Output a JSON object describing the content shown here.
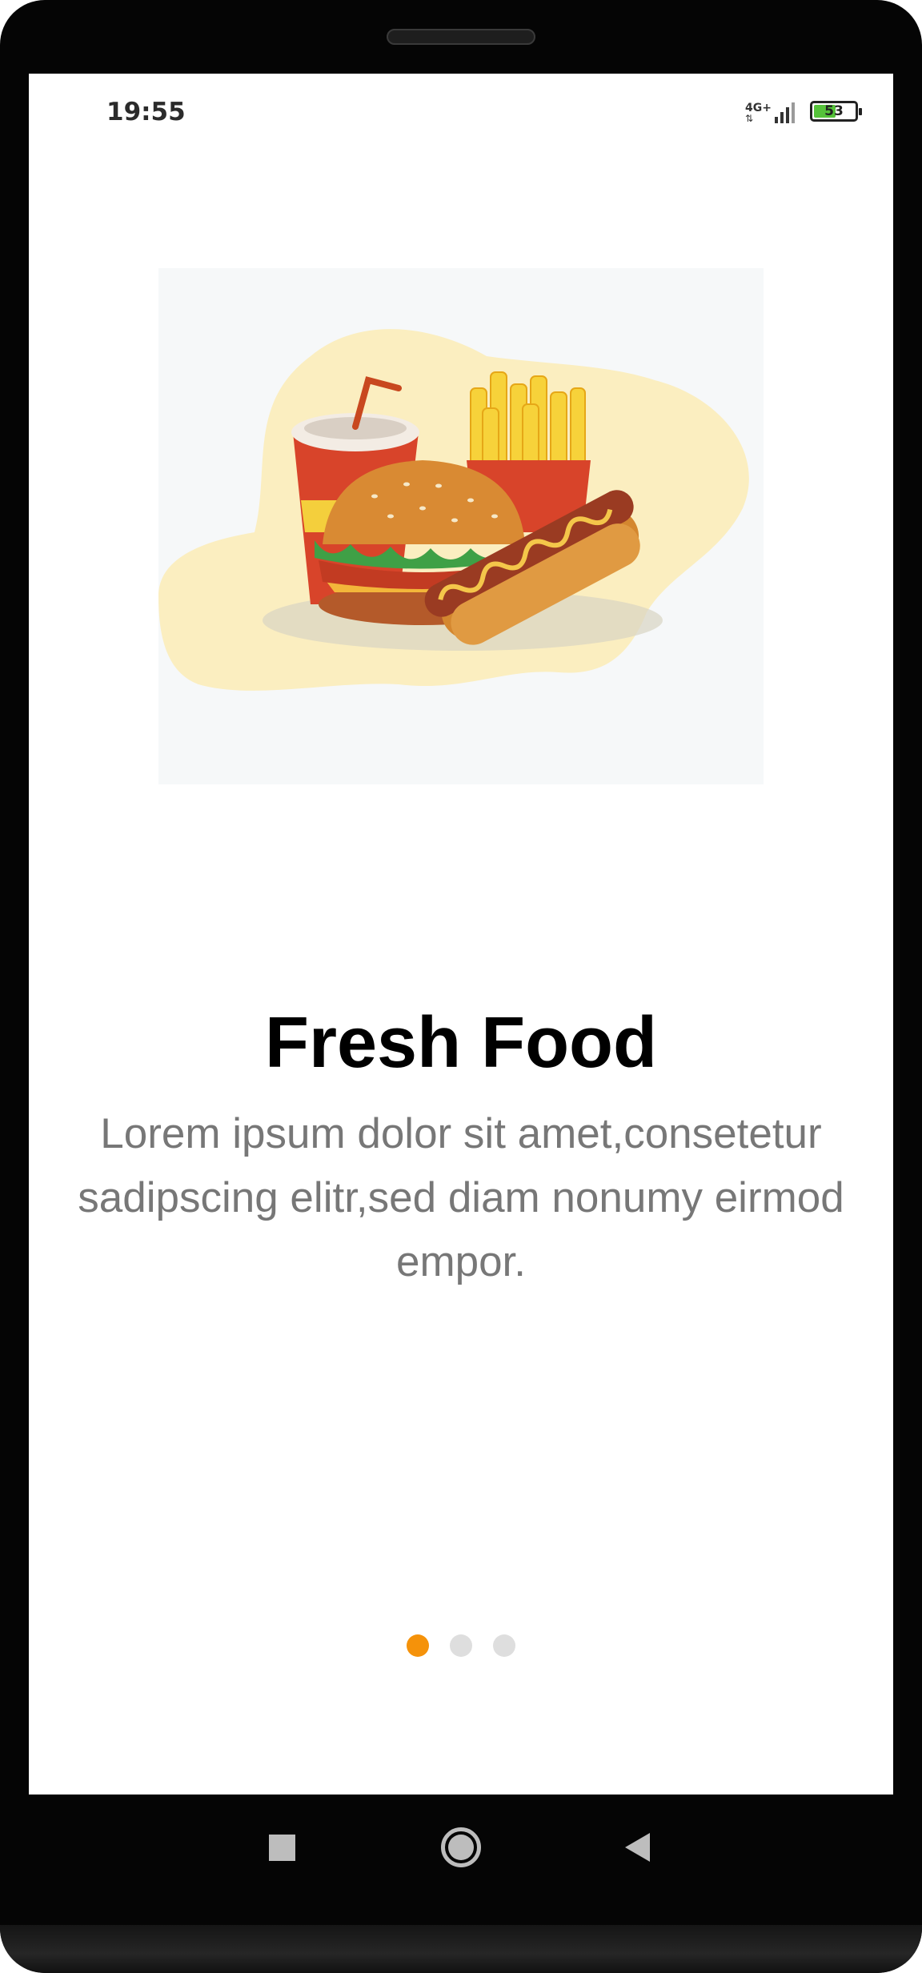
{
  "status_bar": {
    "time": "19:55",
    "network": "4G+",
    "battery": "53",
    "battery_level": 0.53
  },
  "onboarding": {
    "illustration": "fast-food-illustration",
    "title": "Fresh Food",
    "description": "Lorem ipsum dolor sit amet,consetetur sadipscing elitr,sed diam nonumy eirmod empor.",
    "page_indicator": {
      "total": 3,
      "active_index": 0,
      "active_color": "#f5920a",
      "inactive_color": "#dedede"
    }
  },
  "nav_bar": {
    "buttons": [
      "recents-icon",
      "home-icon",
      "back-icon"
    ]
  }
}
